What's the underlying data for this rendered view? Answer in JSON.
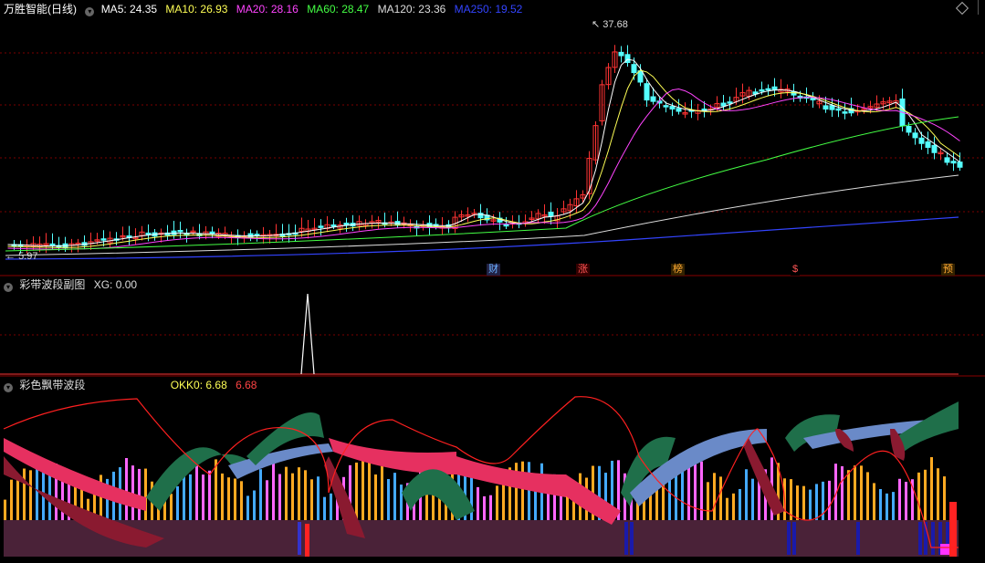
{
  "main_panel": {
    "title": "万胜智能(日线)",
    "ma_labels": [
      {
        "label": "MA5: 24.35",
        "color": "#ffffff"
      },
      {
        "label": "MA10: 26.93",
        "color": "#ffff55"
      },
      {
        "label": "MA20: 28.16",
        "color": "#ff44ff"
      },
      {
        "label": "MA60: 28.47",
        "color": "#44ff44"
      },
      {
        "label": "MA120: 23.36",
        "color": "#dddddd"
      },
      {
        "label": "MA250: 19.52",
        "color": "#3344ff"
      }
    ],
    "price_high": "37.68",
    "price_low": "5.97",
    "events": [
      {
        "text": "财",
        "color": "#6ab0ff",
        "bg": "#224"
      },
      {
        "text": "涨",
        "color": "#ff5555",
        "bg": "#300"
      },
      {
        "text": "榜",
        "color": "#ffaa33",
        "bg": "#320"
      },
      {
        "text": "$",
        "color": "#ff5555",
        "bg": "#000"
      },
      {
        "text": "预",
        "color": "#ffaa33",
        "bg": "#320"
      }
    ]
  },
  "sub_panel_1": {
    "title": "彩带波段副图",
    "value_label": "XG: 0.00"
  },
  "sub_panel_2": {
    "title": "彩色飘带波段",
    "okk_label": "OKK0: 6.68",
    "okk_value": "6.68"
  },
  "colors": {
    "up": "#ff3333",
    "down": "#54ffff",
    "grid": "#7a0000",
    "accent_red": "#ff2020"
  }
}
